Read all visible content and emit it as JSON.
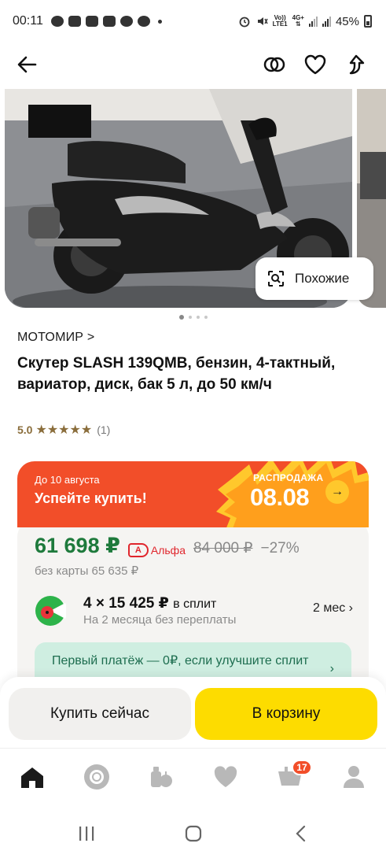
{
  "status": {
    "time": "00:11",
    "net_top": "Vo))",
    "net_bottom": "LTE1",
    "net2_top": "4G+",
    "battery": "45%"
  },
  "gallery": {
    "similar_label": "Похожие",
    "page_count": 4,
    "active_page": 1
  },
  "product": {
    "seller": "МОТОМИР",
    "seller_chevron": ">",
    "title": "Скутер SLASH 139QMB, бензин, 4-тактный, вариатор, диск, бак 5 л, до 50 км/ч",
    "rating": "5.0",
    "stars": "★★★★★",
    "reviews": "(1)"
  },
  "promo": {
    "until": "До 10 августа",
    "call": "Успейте купить!",
    "sale_label": "РАСПРОДАЖА",
    "sale_date": "08.08",
    "arrow": "→"
  },
  "pricing": {
    "price": "61 698 ₽",
    "bank": "Альфа",
    "bank_letter": "А",
    "old_price": "84 000 ₽",
    "discount": "−27%",
    "no_card": "без карты 65 635 ₽"
  },
  "split": {
    "amount": "4 × 15 425 ₽",
    "amount_suffix": "в сплит",
    "subtitle": "На 2 месяца без переплаты",
    "term": "2 мес ›"
  },
  "first_payment": {
    "text": "Первый платёж — 0₽, если улучшите сплит",
    "chevron": "›"
  },
  "actions": {
    "buy_now": "Купить сейчас",
    "to_cart": "В корзину"
  },
  "tabs": {
    "cart_badge": "17"
  },
  "colors": {
    "price_green": "#1e7a3c",
    "promo_orange": "#f24e29",
    "cart_yellow": "#fddc00",
    "rating_gold": "#8a6d3b",
    "alfa_red": "#e0262d"
  },
  "icons": {
    "back": "arrow-left-icon",
    "compare": "compare-icon",
    "favorite": "heart-icon",
    "share": "share-icon",
    "similar": "visual-search-icon",
    "tab_home": "home-icon",
    "tab_alice": "alice-icon",
    "tab_catalog": "catalog-icon",
    "tab_favorites": "heart-icon",
    "tab_cart": "cart-icon",
    "tab_profile": "profile-icon"
  }
}
